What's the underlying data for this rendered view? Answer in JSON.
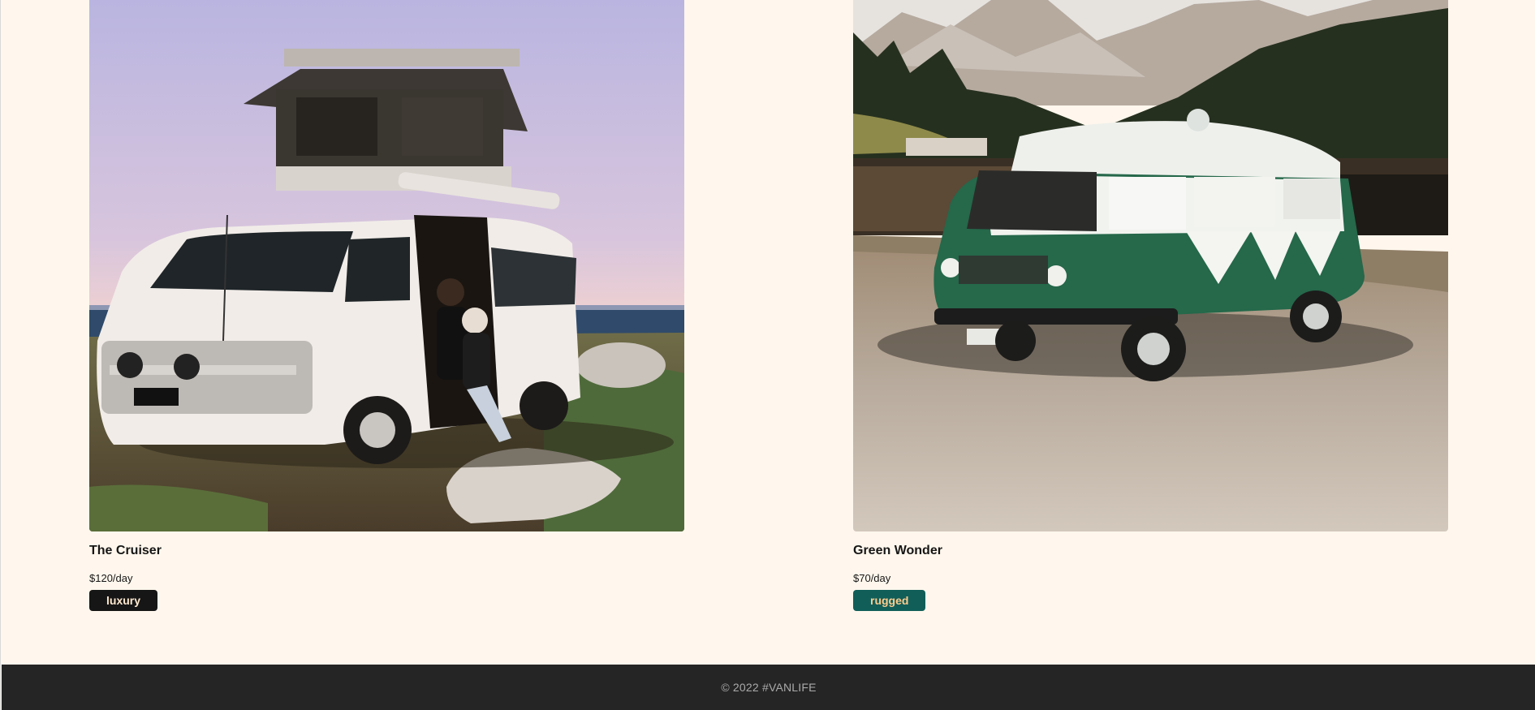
{
  "vans": [
    {
      "name": "The Cruiser",
      "price": "$120/day",
      "type": "luxury",
      "image_alt": "white camper van with rooftop tent by the sea"
    },
    {
      "name": "Green Wonder",
      "price": "$70/day",
      "type": "rugged",
      "image_alt": "green and white vintage van by a mountain lake"
    }
  ],
  "footer": {
    "text": "© 2022 #VANLIFE"
  },
  "colors": {
    "background": "#FFF7ED",
    "luxury_badge": "#161616",
    "rugged_badge": "#115E59",
    "footer_bg": "#252525"
  }
}
